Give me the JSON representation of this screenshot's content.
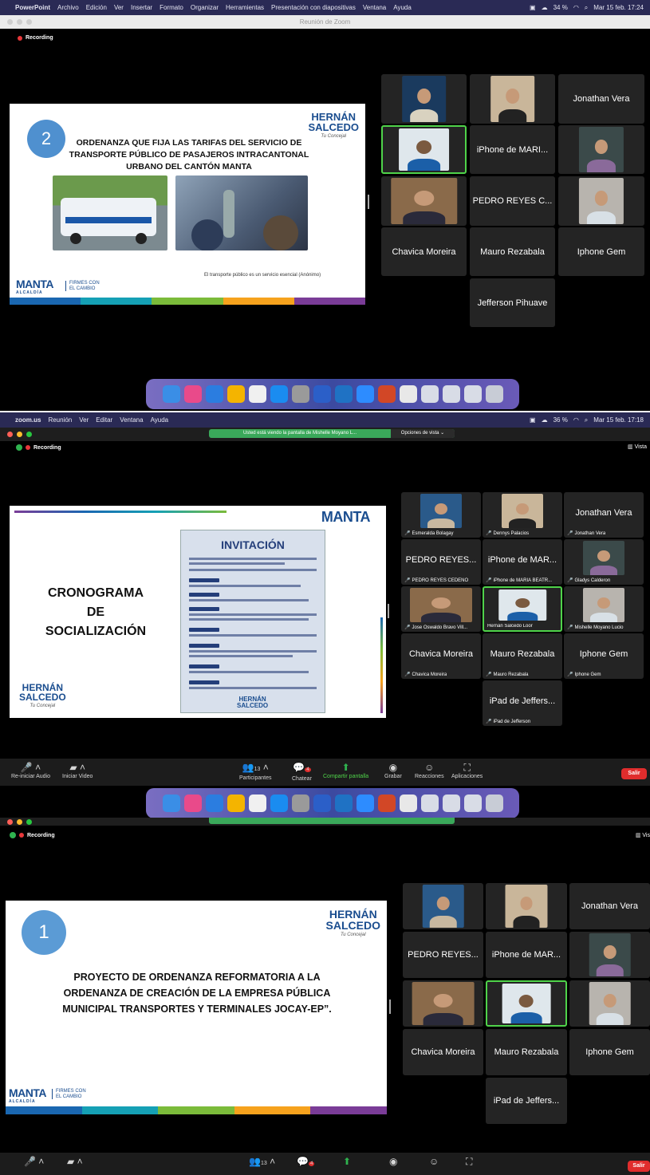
{
  "shot1": {
    "menu": {
      "app": "PowerPoint",
      "items": [
        "Archivo",
        "Edición",
        "Ver",
        "Insertar",
        "Formato",
        "Organizar",
        "Herramientas",
        "Presentación con diapositivas",
        "Ventana",
        "Ayuda"
      ],
      "battery": "34 %",
      "datetime": "Mar 15 feb. 17:24"
    },
    "window_title": "Reunión de Zoom",
    "recording": "Recording",
    "slide": {
      "number": "2",
      "title_line1": "ORDENANZA QUE FIJA LAS TARIFAS DEL SERVICIO DE",
      "title_line2": "TRANSPORTE PÚBLICO DE PASAJEROS INTRACANTONAL",
      "title_line3": "URBANO DEL CANTÓN MANTA",
      "brand": "HERNÁN",
      "brand2": "SALCEDO",
      "brand_sub": "Tu Concejal",
      "quote": "El transporte público es un servicio esencial (Anónimo)",
      "manta": "MANTA",
      "alcaldia": "ALCALDÍA",
      "firmes1": "FIRMES CON",
      "firmes2": "EL CAMBIO"
    },
    "participants": [
      "Jonathan Vera",
      "iPhone de MARI...",
      "PEDRO REYES C...",
      "Chavica Moreira",
      "Mauro Rezabala",
      "Iphone Gem",
      "Jefferson Pihuave"
    ]
  },
  "shot2": {
    "menu": {
      "app": "zoom.us",
      "items": [
        "Reunión",
        "Ver",
        "Editar",
        "Ventana",
        "Ayuda"
      ],
      "battery": "36 %",
      "datetime": "Mar 15 feb. 17:18"
    },
    "banner": "Usted está viendo la pantalla de Mishelle Moyano L...",
    "view_options": "Opciones de vista ⌄",
    "recording": "Recording",
    "vista": "Vista",
    "slide": {
      "title1": "CRONOGRAMA",
      "title2": "DE",
      "title3": "SOCIALIZACIÓN",
      "invite_title": "INVITACIÓN",
      "brand": "HERNÁN",
      "brand2": "SALCEDO",
      "brand_sub": "Tu Concejal",
      "manta": "MANTA"
    },
    "tiles": [
      {
        "name": "",
        "label": "Esmeralda Bolagay"
      },
      {
        "name": "",
        "label": "Dennys Palacios"
      },
      {
        "name": "Jonathan Vera",
        "label": "Jonathan Vera"
      },
      {
        "name": "PEDRO REYES...",
        "label": "PEDRO REYES CEDEÑO"
      },
      {
        "name": "iPhone de MAR...",
        "label": "iPhone de MARIA BEATR..."
      },
      {
        "name": "",
        "label": "Gladys Calderon"
      },
      {
        "name": "",
        "label": "Jose Oswaldo Bravo Vill..."
      },
      {
        "name": "",
        "label": "Hernán Salcedo Loor"
      },
      {
        "name": "",
        "label": "Mishelle Moyano Lucio"
      },
      {
        "name": "Chavica Moreira",
        "label": "Chavica Moreira"
      },
      {
        "name": "Mauro Rezabala",
        "label": "Mauro Rezabala"
      },
      {
        "name": "Iphone Gem",
        "label": "Iphone Gem"
      },
      {
        "name": "iPad de Jeffers...",
        "label": "iPad de Jefferson"
      }
    ],
    "toolbar": {
      "audio": "Re-iniciar Audio",
      "video": "Iniciar Video",
      "participants": "Participantes",
      "participants_count": "13",
      "chat": "Chatear",
      "chat_badge": "4",
      "share": "Compartir pantalla",
      "record": "Grabar",
      "reactions": "Reacciones",
      "apps": "Aplicaciones",
      "leave": "Salir"
    }
  },
  "shot3": {
    "recording": "Recording",
    "vista": "Vis",
    "slide": {
      "number": "1",
      "title_line1": "PROYECTO DE ORDENANZA REFORMATORIA A LA",
      "title_line2": "ORDENANZA DE CREACIÓN DE LA EMPRESA PÚBLICA",
      "title_line3": "MUNICIPAL TRANSPORTES Y TERMINALES JOCAY-EP”.",
      "brand": "HERNÁN",
      "brand2": "SALCEDO",
      "brand_sub": "Tu Concejal",
      "manta": "MANTA",
      "alcaldia": "ALCALDÍA",
      "firmes1": "FIRMES CON",
      "firmes2": "EL CAMBIO"
    },
    "participants": [
      "Jonathan Vera",
      "PEDRO REYES...",
      "iPhone de MAR...",
      "Chavica Moreira",
      "Mauro Rezabala",
      "Iphone Gem",
      "iPad de Jeffers..."
    ],
    "toolbar": {
      "participants_count": "13",
      "chat_badge": "4",
      "leave": "Salir"
    }
  },
  "colors": {
    "recording": "#e8373a",
    "active_speaker": "#4fd34a",
    "leave": "#e02d2d",
    "share": "#2fb34f",
    "slide_circle": "#4f90cf",
    "brand_blue": "#1a4d8f"
  }
}
